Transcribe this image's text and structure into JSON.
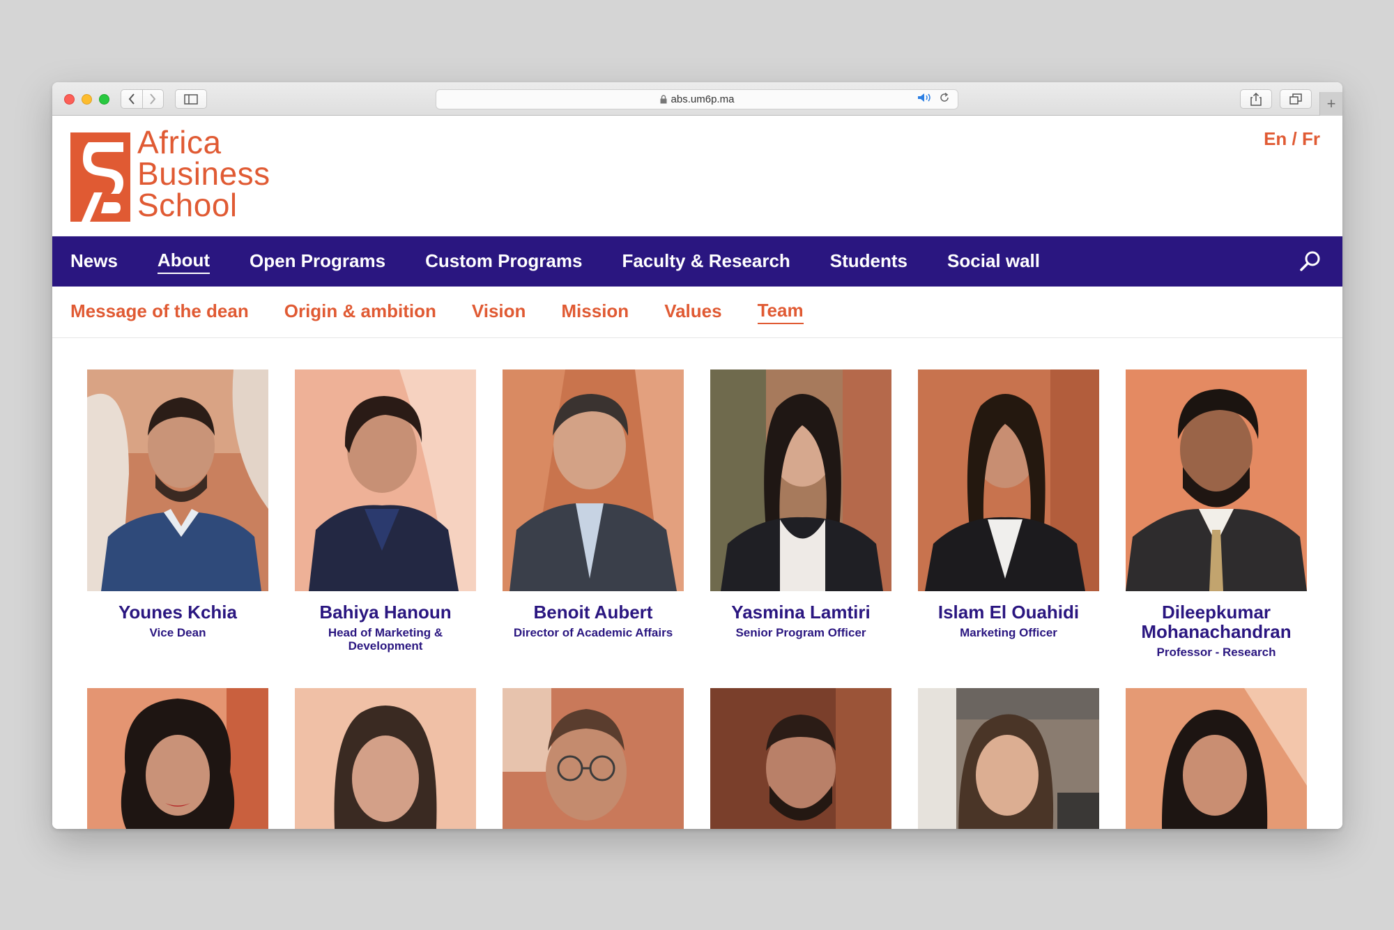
{
  "browser": {
    "url": "abs.um6p.ma"
  },
  "brand": {
    "line1": "Africa",
    "line2": "Business",
    "line3": "School",
    "color": "#e05a33",
    "nav_color": "#2a1680"
  },
  "lang": {
    "label": "En / Fr"
  },
  "main_nav": {
    "items": [
      {
        "label": "News"
      },
      {
        "label": "About"
      },
      {
        "label": "Open Programs"
      },
      {
        "label": "Custom Programs"
      },
      {
        "label": "Faculty & Research"
      },
      {
        "label": "Students"
      },
      {
        "label": "Social wall"
      }
    ],
    "active": "About"
  },
  "sub_nav": {
    "items": [
      {
        "label": "Message of the dean"
      },
      {
        "label": "Origin & ambition"
      },
      {
        "label": "Vision"
      },
      {
        "label": "Mission"
      },
      {
        "label": "Values"
      },
      {
        "label": "Team"
      }
    ],
    "active": "Team"
  },
  "team": {
    "row1": [
      {
        "name": "Younes Kchia",
        "role": "Vice Dean"
      },
      {
        "name": "Bahiya Hanoun",
        "role": "Head of Marketing & Development"
      },
      {
        "name": "Benoit Aubert",
        "role": "Director of Academic Affairs"
      },
      {
        "name": "Yasmina Lamtiri",
        "role": "Senior Program Officer"
      },
      {
        "name": "Islam El Ouahidi",
        "role": "Marketing Officer"
      },
      {
        "name": "Dileepkumar Mohanachandran",
        "role": "Professor - Research"
      }
    ]
  }
}
